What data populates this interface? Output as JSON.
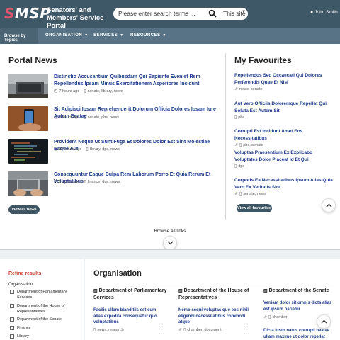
{
  "header": {
    "logo_first": "S",
    "logo_rest": "MSP",
    "portal_title": "Senators' and Members' Service Portal",
    "search_placeholder": "Please enter search terms ...",
    "search_scope": "This site",
    "user_name": "John Smith"
  },
  "nav": {
    "topics": "Browse by Topics",
    "items": [
      {
        "label": "ORGANISATION"
      },
      {
        "label": "SERVICES"
      },
      {
        "label": "RESOURCES"
      }
    ]
  },
  "portal_news": {
    "title": "Portal News",
    "items": [
      {
        "title": "Distinctio Accusantium Quibusdam Qui Sapiente Eveniet Rem Repellendus Ipsam Minus Exercitationem Asperiores Incidunt",
        "time": "7 hours ago",
        "tags": "senate, library, news"
      },
      {
        "title": "Sit Adipisci Ipsam Reprehenderit Dolorum Officia Dolores Ipsam Iure Autem Beatae",
        "time": "3 hours ago",
        "tags": "senate, pbs, news"
      },
      {
        "title": "Provident Neque Ut Sunt Fuga Et Dolores Dolor Est Sint Molestiae Eaque Aut",
        "time": "10 hours ago",
        "tags": "library, dps, news"
      },
      {
        "title": "Consequuntur Eaque Culpa Rem Laborum Porro Et Quia Rerum Et Voluptatibus",
        "time": "5 hours ago",
        "tags": "finance, dps, news"
      }
    ],
    "view_all": "View all news"
  },
  "favourites": {
    "title": "My Favourites",
    "items": [
      {
        "title": "Repellendus Sed Occaecati Qui Dolores Perferendis Quae Et Nisi",
        "tags": "news, senate"
      },
      {
        "title": "Aut Vero Officiis Doloremque Repellat Qui Soluta Est Autem Sit",
        "tags": "pbs"
      },
      {
        "title": "Corrupti Est Incidunt Amet Eos Necessitatibus",
        "tags": "pbs, senate"
      },
      {
        "title": "Voluptas Praesentium Ex Explicabo Voluptates Dolor Placeat Id Et Qui",
        "tags": "dps"
      },
      {
        "title": "Corporis Ea Necessitatibus Ipsum Alias Quia Vero Ex Veritatis Sint",
        "tags": "senate, news"
      }
    ],
    "view_all": "View all favourites"
  },
  "browse_all": "Browse all links",
  "refine": {
    "title": "Refine results",
    "subtitle": "Organisation",
    "facets": [
      {
        "label": "Department of Parliamentary Services"
      },
      {
        "label": "Department of the House of Representatives"
      },
      {
        "label": "Department of the Senate"
      },
      {
        "label": "Finance"
      },
      {
        "label": "Library"
      }
    ]
  },
  "organisation": {
    "title": "Organisation",
    "columns": [
      {
        "title": "Department of Parliamentary Services",
        "links": [
          {
            "text": "Facilis ullam blanditiis est cum alias expedita consequatur quo voluptatibus",
            "tags": "news, research"
          }
        ]
      },
      {
        "title": "Department of the House of Representatives",
        "links": [
          {
            "text": "Nemo sequi voluptas quo eos nihil eligendi necessitatibus commodi atque",
            "tags": "chamber, document"
          }
        ]
      },
      {
        "title": "Department of the Senate",
        "links": [
          {
            "text": "Veniam dolor sit omnis dicta alias est ipsum pariatur",
            "tags": "chamber"
          },
          {
            "text": "Dicta iusto natus corrupti beatae ullam maxime ut dolor repellat",
            "tags": ""
          }
        ]
      }
    ]
  },
  "colors": {
    "header_bg": "#3f5868",
    "nav_bg": "#577385",
    "link": "#1c3a8a",
    "logo_accent": "#e0566f",
    "refine_title": "#c53b2a"
  }
}
